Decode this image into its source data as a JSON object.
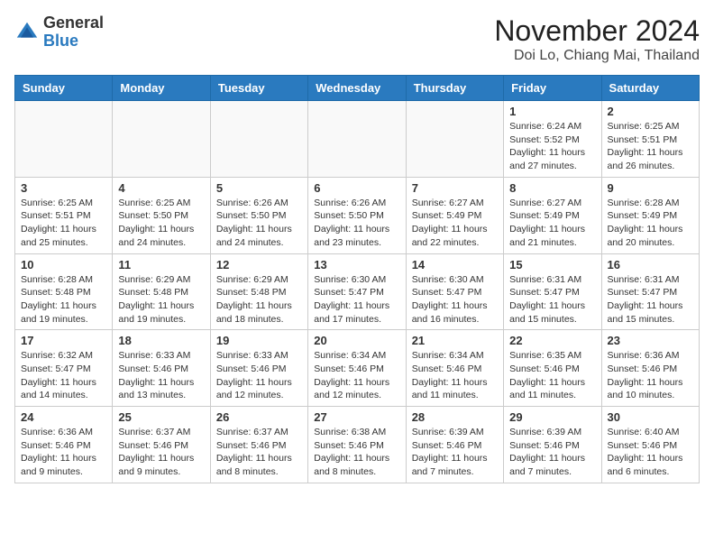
{
  "header": {
    "logo_line1": "General",
    "logo_line2": "Blue",
    "title": "November 2024",
    "subtitle": "Doi Lo, Chiang Mai, Thailand"
  },
  "weekdays": [
    "Sunday",
    "Monday",
    "Tuesday",
    "Wednesday",
    "Thursday",
    "Friday",
    "Saturday"
  ],
  "weeks": [
    [
      {
        "day": "",
        "info": ""
      },
      {
        "day": "",
        "info": ""
      },
      {
        "day": "",
        "info": ""
      },
      {
        "day": "",
        "info": ""
      },
      {
        "day": "",
        "info": ""
      },
      {
        "day": "1",
        "info": "Sunrise: 6:24 AM\nSunset: 5:52 PM\nDaylight: 11 hours\nand 27 minutes."
      },
      {
        "day": "2",
        "info": "Sunrise: 6:25 AM\nSunset: 5:51 PM\nDaylight: 11 hours\nand 26 minutes."
      }
    ],
    [
      {
        "day": "3",
        "info": "Sunrise: 6:25 AM\nSunset: 5:51 PM\nDaylight: 11 hours\nand 25 minutes."
      },
      {
        "day": "4",
        "info": "Sunrise: 6:25 AM\nSunset: 5:50 PM\nDaylight: 11 hours\nand 24 minutes."
      },
      {
        "day": "5",
        "info": "Sunrise: 6:26 AM\nSunset: 5:50 PM\nDaylight: 11 hours\nand 24 minutes."
      },
      {
        "day": "6",
        "info": "Sunrise: 6:26 AM\nSunset: 5:50 PM\nDaylight: 11 hours\nand 23 minutes."
      },
      {
        "day": "7",
        "info": "Sunrise: 6:27 AM\nSunset: 5:49 PM\nDaylight: 11 hours\nand 22 minutes."
      },
      {
        "day": "8",
        "info": "Sunrise: 6:27 AM\nSunset: 5:49 PM\nDaylight: 11 hours\nand 21 minutes."
      },
      {
        "day": "9",
        "info": "Sunrise: 6:28 AM\nSunset: 5:49 PM\nDaylight: 11 hours\nand 20 minutes."
      }
    ],
    [
      {
        "day": "10",
        "info": "Sunrise: 6:28 AM\nSunset: 5:48 PM\nDaylight: 11 hours\nand 19 minutes."
      },
      {
        "day": "11",
        "info": "Sunrise: 6:29 AM\nSunset: 5:48 PM\nDaylight: 11 hours\nand 19 minutes."
      },
      {
        "day": "12",
        "info": "Sunrise: 6:29 AM\nSunset: 5:48 PM\nDaylight: 11 hours\nand 18 minutes."
      },
      {
        "day": "13",
        "info": "Sunrise: 6:30 AM\nSunset: 5:47 PM\nDaylight: 11 hours\nand 17 minutes."
      },
      {
        "day": "14",
        "info": "Sunrise: 6:30 AM\nSunset: 5:47 PM\nDaylight: 11 hours\nand 16 minutes."
      },
      {
        "day": "15",
        "info": "Sunrise: 6:31 AM\nSunset: 5:47 PM\nDaylight: 11 hours\nand 15 minutes."
      },
      {
        "day": "16",
        "info": "Sunrise: 6:31 AM\nSunset: 5:47 PM\nDaylight: 11 hours\nand 15 minutes."
      }
    ],
    [
      {
        "day": "17",
        "info": "Sunrise: 6:32 AM\nSunset: 5:47 PM\nDaylight: 11 hours\nand 14 minutes."
      },
      {
        "day": "18",
        "info": "Sunrise: 6:33 AM\nSunset: 5:46 PM\nDaylight: 11 hours\nand 13 minutes."
      },
      {
        "day": "19",
        "info": "Sunrise: 6:33 AM\nSunset: 5:46 PM\nDaylight: 11 hours\nand 12 minutes."
      },
      {
        "day": "20",
        "info": "Sunrise: 6:34 AM\nSunset: 5:46 PM\nDaylight: 11 hours\nand 12 minutes."
      },
      {
        "day": "21",
        "info": "Sunrise: 6:34 AM\nSunset: 5:46 PM\nDaylight: 11 hours\nand 11 minutes."
      },
      {
        "day": "22",
        "info": "Sunrise: 6:35 AM\nSunset: 5:46 PM\nDaylight: 11 hours\nand 11 minutes."
      },
      {
        "day": "23",
        "info": "Sunrise: 6:36 AM\nSunset: 5:46 PM\nDaylight: 11 hours\nand 10 minutes."
      }
    ],
    [
      {
        "day": "24",
        "info": "Sunrise: 6:36 AM\nSunset: 5:46 PM\nDaylight: 11 hours\nand 9 minutes."
      },
      {
        "day": "25",
        "info": "Sunrise: 6:37 AM\nSunset: 5:46 PM\nDaylight: 11 hours\nand 9 minutes."
      },
      {
        "day": "26",
        "info": "Sunrise: 6:37 AM\nSunset: 5:46 PM\nDaylight: 11 hours\nand 8 minutes."
      },
      {
        "day": "27",
        "info": "Sunrise: 6:38 AM\nSunset: 5:46 PM\nDaylight: 11 hours\nand 8 minutes."
      },
      {
        "day": "28",
        "info": "Sunrise: 6:39 AM\nSunset: 5:46 PM\nDaylight: 11 hours\nand 7 minutes."
      },
      {
        "day": "29",
        "info": "Sunrise: 6:39 AM\nSunset: 5:46 PM\nDaylight: 11 hours\nand 7 minutes."
      },
      {
        "day": "30",
        "info": "Sunrise: 6:40 AM\nSunset: 5:46 PM\nDaylight: 11 hours\nand 6 minutes."
      }
    ]
  ]
}
